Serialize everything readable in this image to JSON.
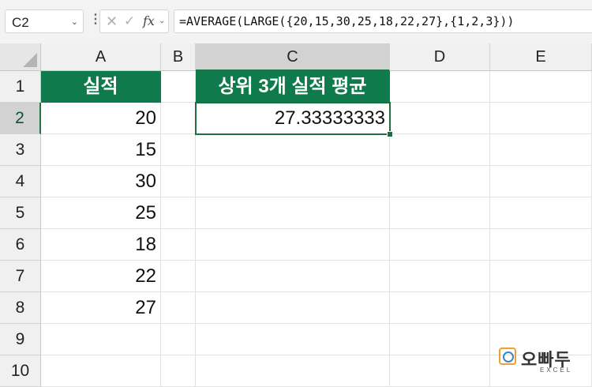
{
  "formula_bar": {
    "name_box": "C2",
    "fx_label": "fx",
    "formula": "=AVERAGE(LARGE({20,15,30,25,18,22,27},{1,2,3}))"
  },
  "columns": [
    "A",
    "B",
    "C",
    "D",
    "E"
  ],
  "rows": [
    "1",
    "2",
    "3",
    "4",
    "5",
    "6",
    "7",
    "8",
    "9",
    "10"
  ],
  "cells": {
    "A1": "실적",
    "A2": "20",
    "A3": "15",
    "A4": "30",
    "A5": "25",
    "A6": "18",
    "A7": "22",
    "A8": "27",
    "C1": "상위 3개 실적 평균",
    "C2": "27.33333333"
  },
  "selected_cell": "C2",
  "colors": {
    "header_fill": "#0f7a4c",
    "selection": "#1e6e42"
  },
  "logo": {
    "text": "오빠두",
    "sub": "EXCEL"
  }
}
